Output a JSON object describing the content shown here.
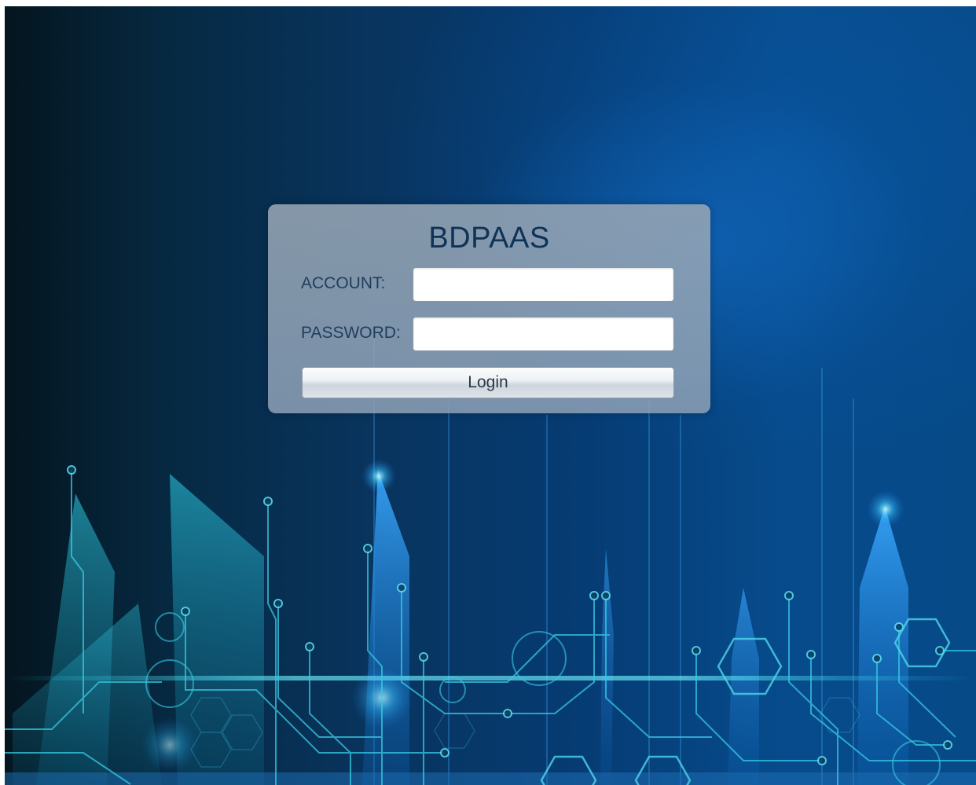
{
  "app": {
    "title": "BDPAAS"
  },
  "login": {
    "account_label": "ACCOUNT:",
    "account_value": "",
    "password_label": "PASSWORD:",
    "password_value": "",
    "button_label": "Login"
  },
  "colors": {
    "title_text": "#0f3358",
    "label_text": "#1f3e5e",
    "background_dark": "#04151f",
    "background_blue": "#074b8c",
    "accent_cyan": "#28c8e6"
  }
}
